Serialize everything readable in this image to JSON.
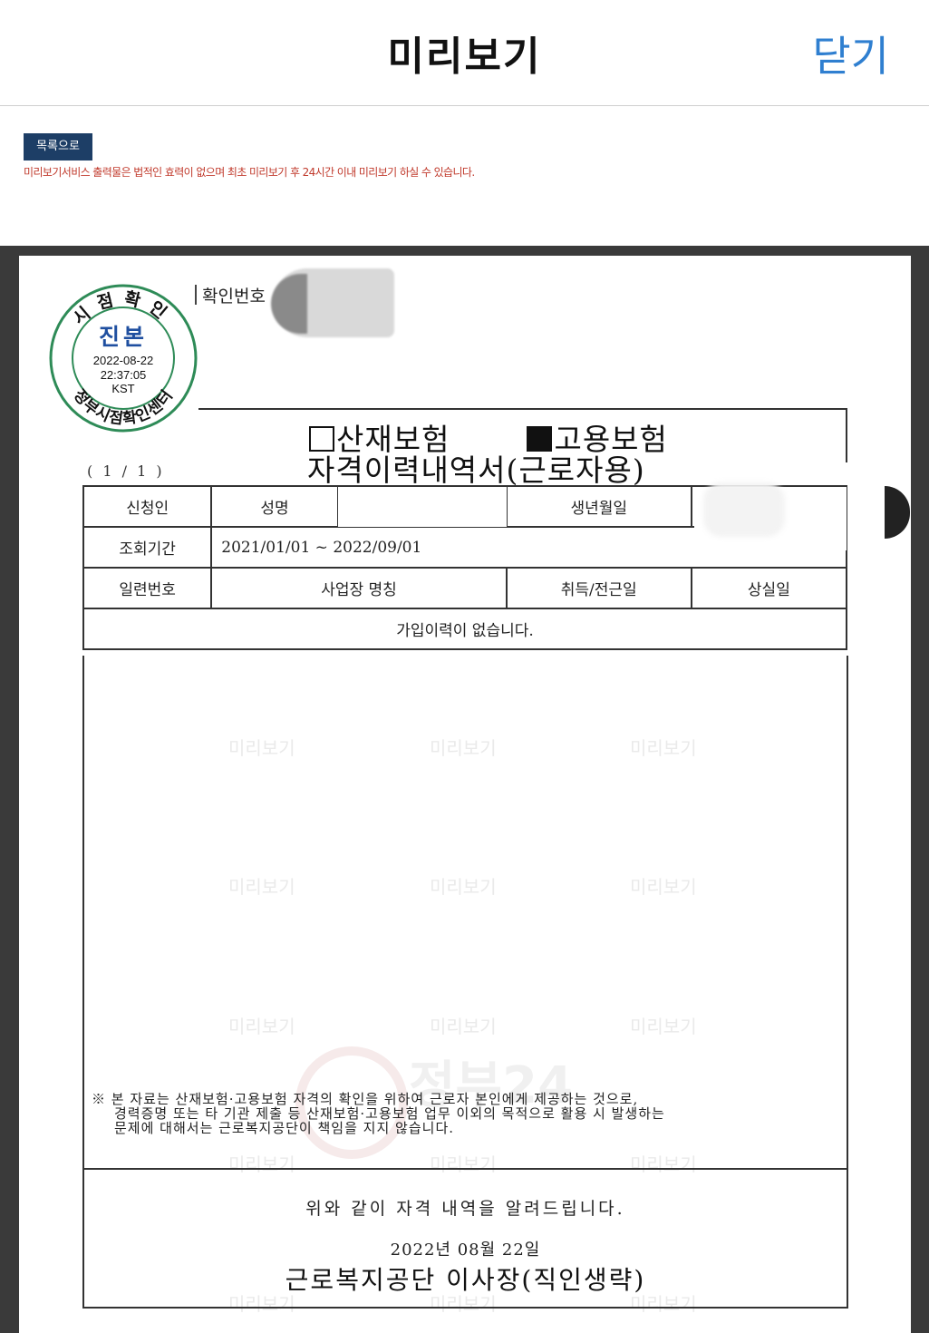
{
  "header": {
    "title": "미리보기",
    "close_label": "닫기"
  },
  "toolbar": {
    "list_button": "목록으로"
  },
  "notice": "미리보기서비스 출력물은 법적인 효력이 없으며 최초 미리보기 후 24시간 이내 미리보기 하실 수 있습니다.",
  "stamp": {
    "top_text": "시점확인",
    "main_text": "진본",
    "date": "2022-08-22",
    "time": "22:37:05",
    "zone": "KST",
    "bottom_text": "정부시점확인센터"
  },
  "document": {
    "confirm_label": "확인번호",
    "checkbox_industrial": "산재보험",
    "checkbox_employment": "고용보험",
    "title": "자격이력내역서(근로자용)",
    "page_count": "( 1 / 1 )",
    "applicant_label": "신청인",
    "name_label": "성명",
    "birth_label": "생년월일",
    "period_label": "조회기간",
    "period_value": "2021/01/01 ~ 2022/09/01",
    "col_serial": "일련번호",
    "col_workplace": "사업장 명칭",
    "col_acquire": "취득/전근일",
    "col_loss": "상실일",
    "empty_message": "가입이력이 없습니다.",
    "watermark": "미리보기",
    "logo_watermark": "정부24",
    "note_mark": "※",
    "note_line1": "본 자료는 산재보험·고용보험 자격의 확인을 위하여 근로자 본인에게 제공하는 것으로,",
    "note_line2": "경력증명 또는 타 기관 제출 등 산재보험·고용보험 업무 이외의 목적으로 활용 시 발생하는",
    "note_line3": "문제에 대해서는 근로복지공단이 책임을 지지 않습니다.",
    "footer_line": "위와 같이 자격 내역을 알려드립니다.",
    "footer_date": "2022년 08월 22일",
    "footer_signature": "근로복지공단 이사장(직인생략)"
  }
}
